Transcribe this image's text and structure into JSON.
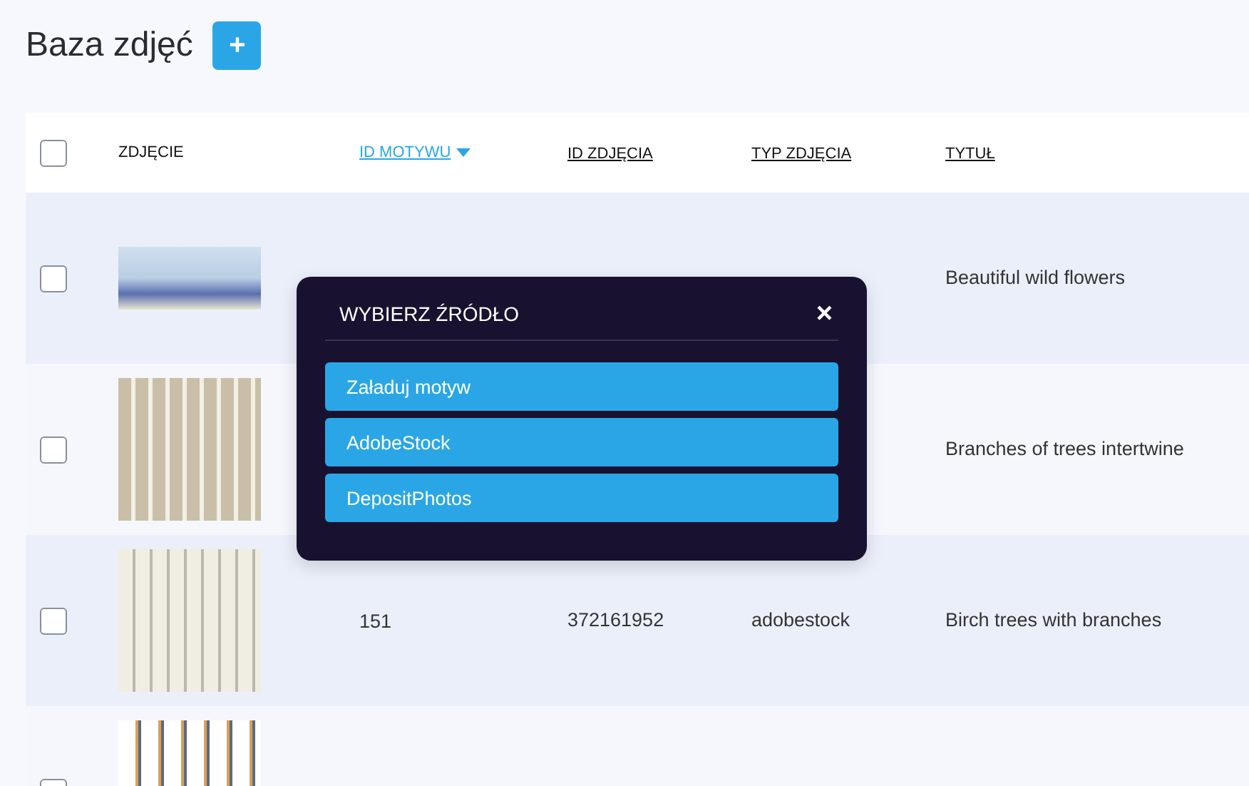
{
  "page": {
    "title": "Baza zdjęć",
    "add_button": "+"
  },
  "table": {
    "header_checked": false,
    "columns": [
      {
        "label": "ZDJĘCIE",
        "sortable": false,
        "sorted": false
      },
      {
        "label": "ID MOTYWU",
        "sortable": true,
        "sorted": true
      },
      {
        "label": "ID ZDJĘCIA",
        "sortable": true,
        "sorted": false
      },
      {
        "label": "TYP ZDJĘCIA",
        "sortable": true,
        "sorted": false
      },
      {
        "label": "TYTUŁ",
        "sortable": true,
        "sorted": false
      }
    ],
    "rows": [
      {
        "checked": false,
        "landscape": true,
        "cells": [
          "",
          "",
          "",
          "",
          "Beautiful wild flowers"
        ]
      },
      {
        "checked": false,
        "landscape": false,
        "cells": [
          "",
          "",
          "",
          "",
          "Branches of trees intertwine"
        ]
      },
      {
        "checked": false,
        "landscape": false,
        "cells": [
          "",
          "151",
          "372161952",
          "adobestock",
          "Birch trees with branches"
        ]
      },
      {
        "checked": false,
        "landscape": false,
        "cells": [
          ""
        ]
      }
    ]
  },
  "dialog": {
    "title": "WYBIERZ ŹRÓDŁO",
    "close": "×",
    "options": [
      "Załaduj motyw",
      "AdobeStock",
      "DepositPhotos"
    ]
  }
}
